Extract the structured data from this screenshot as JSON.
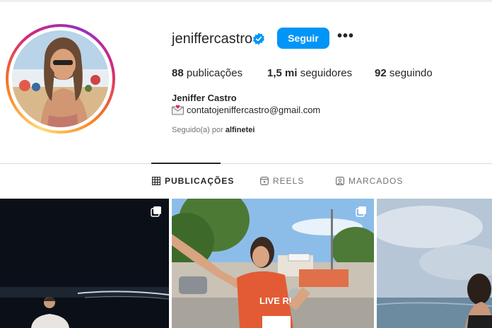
{
  "profile": {
    "username": "jeniffercastro",
    "verified": true,
    "follow_label": "Seguir",
    "more_icon": "more-horizontal-icon",
    "more_label": "•••",
    "full_name": "Jeniffer Castro",
    "email": "contatojeniffercastro@gmail.com",
    "email_icon": "envelope-heart-icon",
    "followed_by_prefix": "Seguido(a) por",
    "followed_by_user": "alfinetei"
  },
  "stats": {
    "posts_value": "88",
    "posts_label": "publicações",
    "followers_value": "1,5 mi",
    "followers_label": "seguidores",
    "following_value": "92",
    "following_label": "seguindo"
  },
  "tabs": [
    {
      "label": "PUBLICAÇÕES",
      "icon": "grid-icon",
      "active": true
    },
    {
      "label": "REELS",
      "icon": "reels-icon",
      "active": false
    },
    {
      "label": "MARCADOS",
      "icon": "tagged-icon",
      "active": false
    }
  ],
  "posts": [
    {
      "name": "post-night-beach",
      "multi": true
    },
    {
      "name": "post-running-race",
      "multi": true,
      "shirt_text": "LIVE RUN"
    },
    {
      "name": "post-ocean",
      "multi": false
    }
  ],
  "colors": {
    "accent": "#0095f6",
    "text": "#262626",
    "muted": "#737373",
    "divider": "#dbdbdb"
  }
}
